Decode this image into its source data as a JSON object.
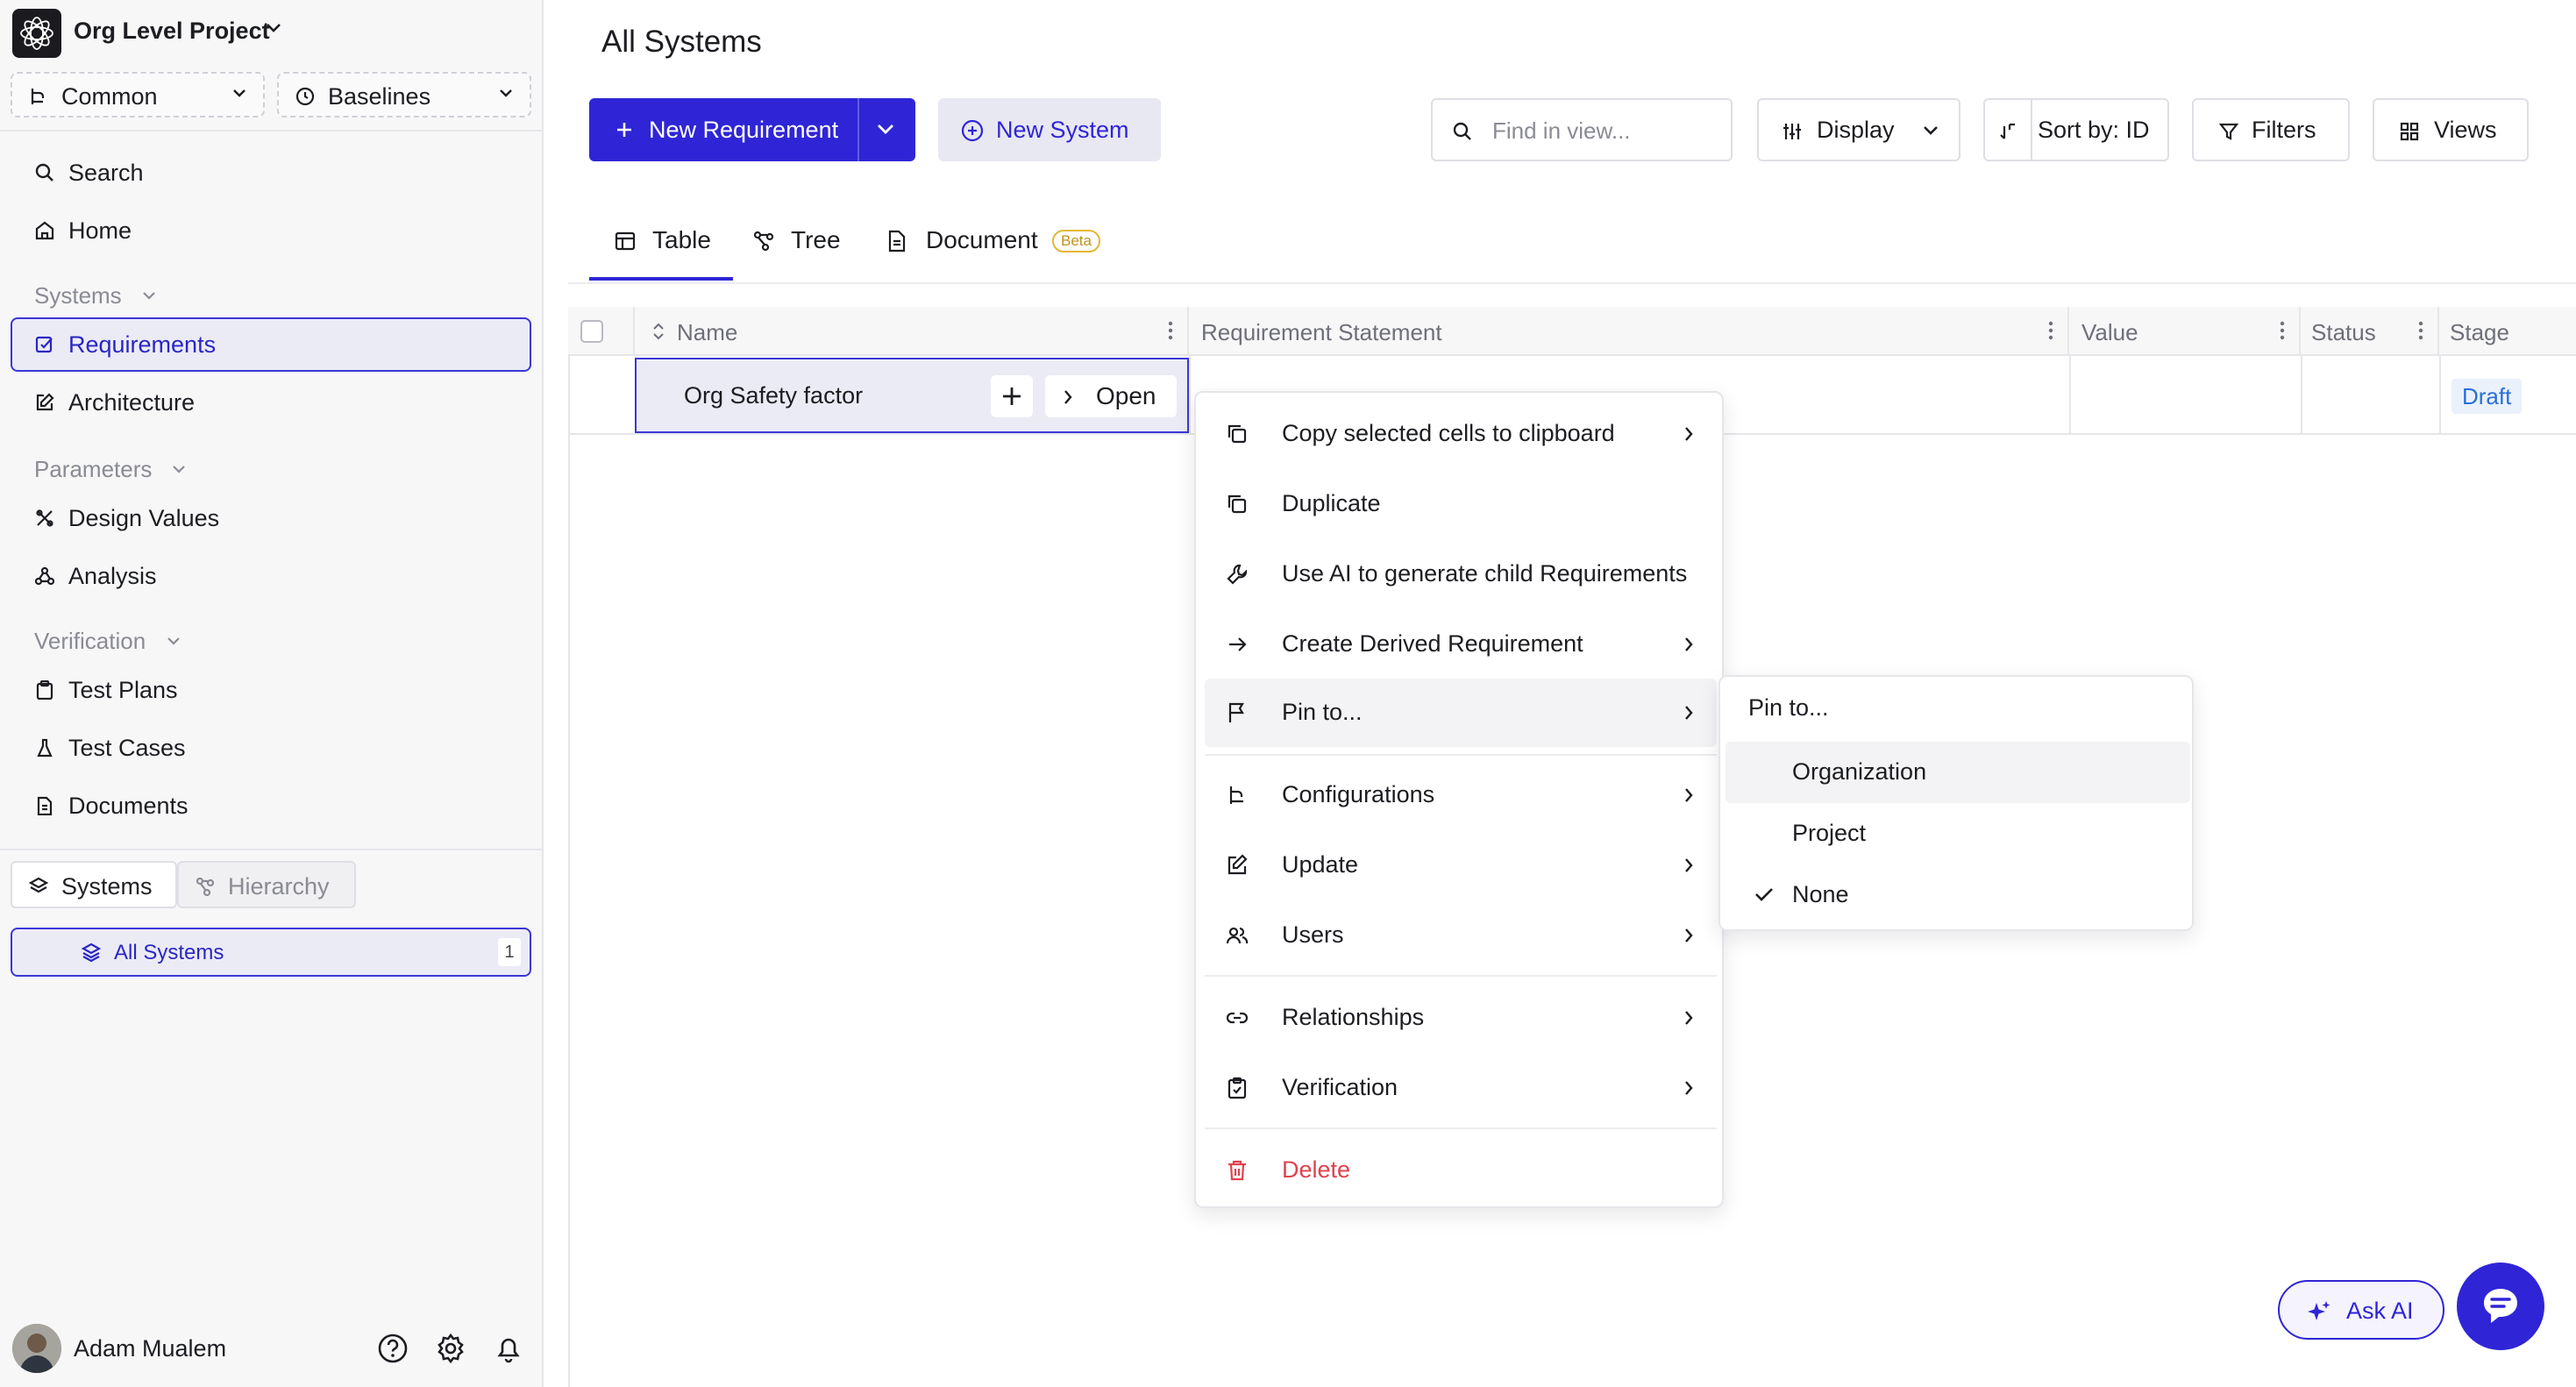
{
  "workspace": {
    "project_name": "Org Level Project"
  },
  "scope": {
    "branch_label": "Common",
    "baselines_label": "Baselines"
  },
  "nav": {
    "search": "Search",
    "home": "Home",
    "systems_header": "Systems",
    "requirements": "Requirements",
    "architecture": "Architecture",
    "parameters_header": "Parameters",
    "design_values": "Design Values",
    "analysis": "Analysis",
    "verification_header": "Verification",
    "test_plans": "Test Plans",
    "test_cases": "Test Cases",
    "documents": "Documents"
  },
  "tree_toggle": {
    "systems": "Systems",
    "hierarchy": "Hierarchy"
  },
  "systems_list": [
    {
      "label": "All Systems",
      "count": "1"
    }
  ],
  "user": {
    "name": "Adam Mualem"
  },
  "main": {
    "title": "All Systems",
    "new_requirement": "New Requirement",
    "new_system": "New System",
    "search_placeholder": "Find in view...",
    "display": "Display",
    "sort": "Sort by: ID",
    "filters": "Filters",
    "views": "Views"
  },
  "tabs": {
    "table": "Table",
    "tree": "Tree",
    "document": "Document",
    "beta": "Beta"
  },
  "table": {
    "columns": {
      "name": "Name",
      "statement": "Requirement Statement",
      "value": "Value",
      "status": "Status",
      "stage": "Stage"
    },
    "rows": [
      {
        "name": "Org Safety factor",
        "open_label": "Open",
        "stage": "Draft"
      }
    ]
  },
  "context_menu": {
    "copy": "Copy selected cells to clipboard",
    "duplicate": "Duplicate",
    "use_ai": "Use AI to generate child Requirements",
    "derived": "Create Derived Requirement",
    "pin": "Pin to...",
    "configurations": "Configurations",
    "update": "Update",
    "users": "Users",
    "relationships": "Relationships",
    "verification": "Verification",
    "delete": "Delete"
  },
  "pin_submenu": {
    "header": "Pin to...",
    "organization": "Organization",
    "project": "Project",
    "none": "None",
    "selected": "None"
  },
  "floating": {
    "ask_ai": "Ask AI"
  },
  "colors": {
    "accent": "#2f25d6",
    "danger": "#e0424f",
    "draft": "#2a6fd6"
  }
}
